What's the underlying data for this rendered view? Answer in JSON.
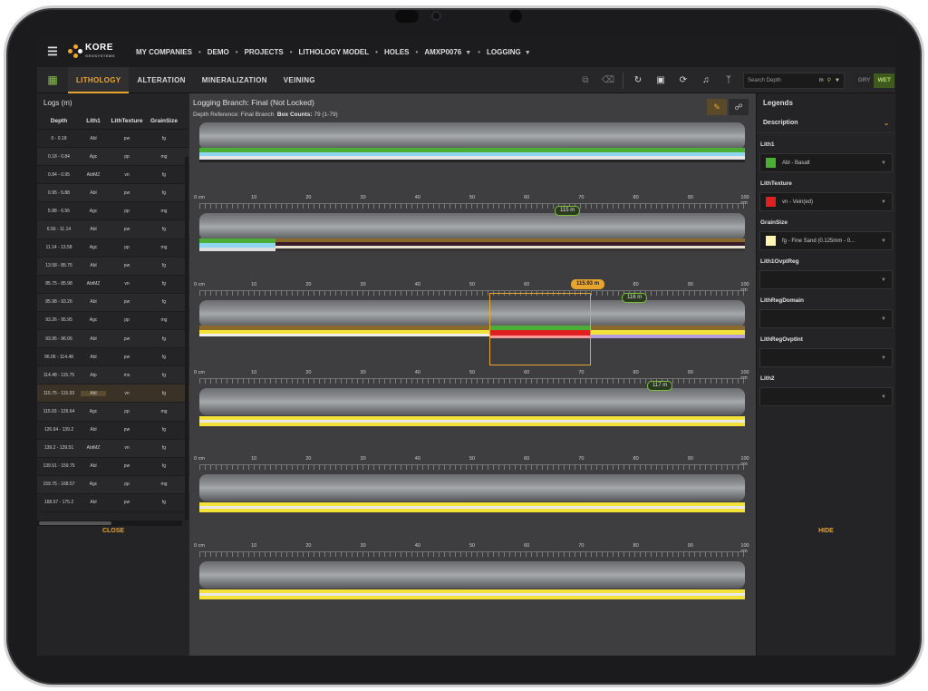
{
  "nav": {
    "logo_main": "KORE",
    "logo_sub": "GEOSYSTEMS",
    "breadcrumbs": [
      "MY COMPANIES",
      "DEMO",
      "PROJECTS",
      "LITHOLOGY MODEL",
      "HOLES",
      "AMXP0076",
      "LOGGING"
    ]
  },
  "tabs": [
    "LITHOLOGY",
    "ALTERATION",
    "MINERALIZATION",
    "VEINING"
  ],
  "toolbar": {
    "search_placeholder": "Search Depth",
    "search_unit": "m",
    "dry": "DRY",
    "wet": "WET"
  },
  "logs": {
    "title": "Logs (m)",
    "columns": [
      "Depth",
      "Lith1",
      "LithTexture",
      "GrainSize"
    ],
    "rows": [
      [
        "0 - 0.18",
        "Abl",
        "pw",
        "fg"
      ],
      [
        "0.18 - 0.84",
        "Agc",
        "pp",
        "mg"
      ],
      [
        "0.84 - 0.95",
        "AbtMZ",
        "vn",
        "fg"
      ],
      [
        "0.95 - 5.88",
        "Abl",
        "pw",
        "fg"
      ],
      [
        "5.88 - 6.56",
        "Agc",
        "pp",
        "mg"
      ],
      [
        "6.56 - 11.14",
        "Abl",
        "pw",
        "fg"
      ],
      [
        "11.14 - 13.58",
        "Agc",
        "pp",
        "mg"
      ],
      [
        "13.58 - 85.75",
        "Abl",
        "pw",
        "fg"
      ],
      [
        "85.75 - 85.98",
        "AbtMZ",
        "vn",
        "fg"
      ],
      [
        "85.98 - 93.26",
        "Abl",
        "pw",
        "fg"
      ],
      [
        "93.26 - 95.95",
        "Agc",
        "pp",
        "mg"
      ],
      [
        "93.95 - 96.06",
        "Abl",
        "pw",
        "fg"
      ],
      [
        "96.06 - 114.48",
        "Abl",
        "pw",
        "fg"
      ],
      [
        "114.48 - 115.75",
        "Alp",
        "ms",
        "fg"
      ],
      [
        "115.75 - 115.93",
        "Abl",
        "vn",
        "fg"
      ],
      [
        "115.93 - 126.64",
        "Agc",
        "pp",
        "mg"
      ],
      [
        "126.64 - 139.2",
        "Abl",
        "pw",
        "fg"
      ],
      [
        "139.2 - 139.51",
        "AbtMZ",
        "vn",
        "fg"
      ],
      [
        "139.51 - 159.75",
        "Abl",
        "pw",
        "fg"
      ],
      [
        "159.75 - 168.57",
        "Agc",
        "pp",
        "mg"
      ],
      [
        "168.57 - 175.2",
        "Abl",
        "pw",
        "fg"
      ]
    ],
    "selected_index": 14,
    "close_label": "CLOSE"
  },
  "main": {
    "branch_label": "Logging Branch:",
    "branch_value": "Final",
    "branch_status": "(Not Locked)",
    "depth_ref_label": "Depth Reference:",
    "depth_ref_value": "Final Branch",
    "box_counts_label": "Box Counts:",
    "box_counts_value": "79 (1-79)",
    "ruler_ticks": [
      "0 cm",
      "10",
      "20",
      "30",
      "40",
      "50",
      "60",
      "70",
      "80",
      "90",
      "100 cm"
    ],
    "depth_markers": [
      "115 m",
      "116 m",
      "117 m"
    ],
    "selection_depth": "115.93 m"
  },
  "legends": {
    "title": "Legends",
    "description": "Description",
    "fields": [
      {
        "label": "Lith1",
        "value": "Abl - Basalt",
        "color": "#4caf35"
      },
      {
        "label": "LithTexture",
        "value": "vn - Vein(ed)",
        "color": "#e02020"
      },
      {
        "label": "GrainSize",
        "value": "fg - Fine Sand (0.125mm - 0...",
        "color": "#fff5b0"
      },
      {
        "label": "Lith1OvptReg",
        "value": ""
      },
      {
        "label": "LithRegDomain",
        "value": ""
      },
      {
        "label": "LithRegOvptInt",
        "value": ""
      },
      {
        "label": "Lith2",
        "value": ""
      }
    ],
    "hide_label": "HIDE"
  },
  "colors": {
    "accent": "#e8a52d",
    "green": "#4caf35",
    "yellow": "#f2e23a"
  }
}
